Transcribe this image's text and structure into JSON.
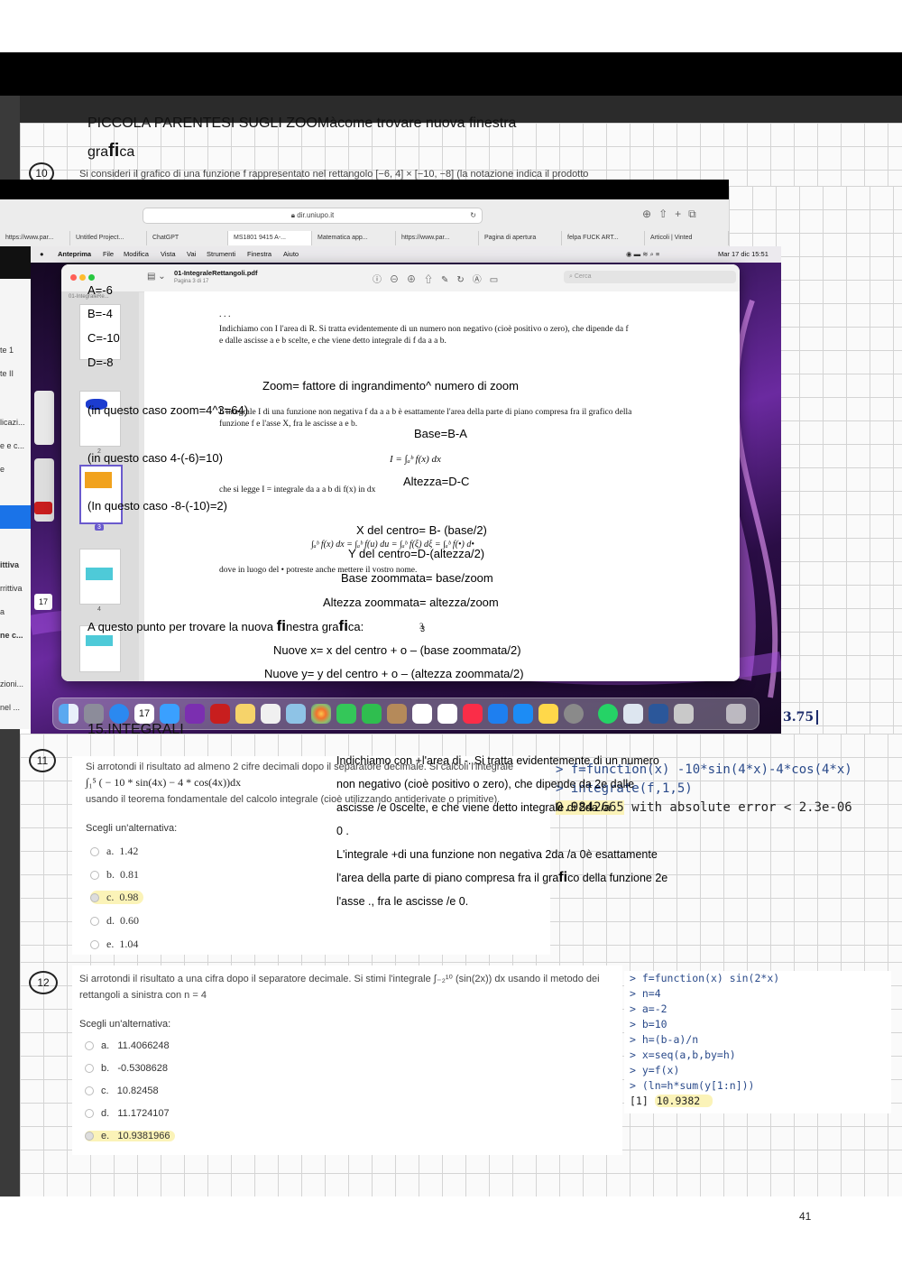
{
  "heading": {
    "line1": "PICCOLA PARENTESI SUGLI ZOOMàcome trovare nuova fi",
    "line1b": "nestra",
    "line2a": "gra",
    "line2b": "fi",
    "line2c": "ca"
  },
  "q10": {
    "number": "10",
    "text": "Si consideri il grafico di una funzione f rappresentato nel rettangolo [−6, 4] × [−10, −8] (la notazione indica il prodotto"
  },
  "browser": {
    "url": "dir.uniupo.it",
    "tabs": [
      "https://www.par...",
      "Untitled Project...",
      "ChatGPT",
      "MS1801 9415 A-...",
      "Matematica app...",
      "https://www.par...",
      "Pagina di apertura",
      "felpa FUCK ART...",
      "Articoli | Vinted"
    ]
  },
  "menubar": {
    "items": [
      "Anteprima",
      "File",
      "Modifica",
      "Vista",
      "Vai",
      "Strumenti",
      "Finestra",
      "Aiuto"
    ],
    "clock": "Mar 17 dic  15:51"
  },
  "preview": {
    "filename": "01-IntegraleRettangoli.pdf",
    "page": "Pagina 3 di 17",
    "search_placeholder": "Cerca",
    "sidebar_label": "01-IntegraleRe...",
    "thumb_numbers": [
      "2",
      "3",
      "4"
    ]
  },
  "left_sidebar": [
    "te 1",
    "te II",
    "licazi...",
    "e e c...",
    "e",
    "ittiva",
    "rrittiva",
    "a",
    "ne c...",
    "zioni...",
    "nel ..."
  ],
  "pdf_text": {
    "dots": ". . .",
    "p1": "Indichiamo con I l'area di R. Si tratta evidentemente di un numero non negativo (cioè positivo o zero), che dipende da f e dalle ascisse a e b scelte, e che viene detto integrale di f da a a b.",
    "p2": "L'integrale I di una funzione non negativa f da a a b è esattamente l'area della parte di piano compresa fra il grafico della funzione f e l'asse X, fra le ascisse a e b.",
    "formula": "I = ∫ₐᵇ f(x) dx",
    "p3": "che si legge  I = integrale da a a b di f(x) in dx",
    "formula2": "∫ₐᵇ f(x) dx = ∫ₐᵇ f(u) du = ∫ₐᵇ f(ξ) dξ = ∫ₐᵇ f(•) d•",
    "p4": "dove in luogo del • potreste anche mettere il vostro nome.",
    "page_num": "3"
  },
  "overlay": {
    "A": "A=-6",
    "B": "B=-4",
    "C": "C=-10",
    "D": "D=-8",
    "zoom": "Zoom= fattore di ingrandimento^ numero di zoom",
    "case1": "(in questo caso zoom=4^3=64)",
    "base": "Base=B-A",
    "case2": "(in questo caso 4-(-6)=10)",
    "altezza": "Altezza=D-C",
    "case3": "(In questo caso -8-(-10)=2)",
    "xc": "X del centro= B- (base/2)",
    "yc": "Y del centro=D-(altezza/2)",
    "bz": "Base zoommata= base/zoom",
    "az": "Altezza zoommata= altezza/zoom",
    "nf1": "A questo punto per trovare la nuova ",
    "nf2": "fi",
    "nf3": "nestra gra",
    "nf4": "fi",
    "nf5": "ca:",
    "page3": "3",
    "nx": "Nuove x= x del centro + o – (base zoommata/2)",
    "ny": "Nuove y= y del centro + o – (altezza zoommata/2)",
    "section": "15.INTEGRALI",
    "p1": "Indichiamo con +l'area di -. Si tratta evidentemente di un numero",
    "p2": "non negativo (cioè positivo o zero), che dipende da 2e dalle",
    "p3": "ascisse /e 0scelte, e che viene detto integrale di 2da /a",
    "p4": "0 .",
    "p5": "L'integrale +di una funzione non negativa 2da /a 0è esattamente",
    "p6a": "l'area della parte di piano compresa fra il gra",
    "p6b": "fi",
    "p6c": "co della funzione 2e",
    "p7": "l'asse ., fra le ascisse /e 0."
  },
  "handwriting": {
    "score": "3.75"
  },
  "q11": {
    "number": "11",
    "text1": "Si arrotondi il risultato ad almeno 2 cifre decimali dopo il separatore decimale. Si calcoli l'integrale",
    "integral": "∫₁⁵ ( − 10 * sin(4x) − 4 * cos(4x))dx",
    "text2": "usando il teorema fondamentale del calcolo integrale (cioè utilizzando antiderivate o primitive).",
    "prompt": "Scegli un'alternativa:",
    "choices": [
      {
        "letter": "a.",
        "value": "1.42"
      },
      {
        "letter": "b.",
        "value": "0.81"
      },
      {
        "letter": "c.",
        "value": "0.98"
      },
      {
        "letter": "d.",
        "value": "0.60"
      },
      {
        "letter": "e.",
        "value": "1.04"
      }
    ],
    "selected": 2,
    "code1": "> f=function(x) -10*sin(4*x)-4*cos(4*x)",
    "code2": "> integrate(f,1,5)",
    "result_val": "0.9842665",
    "result_rest": " with absolute error < 2.3e-06"
  },
  "q12": {
    "number": "12",
    "text1": "Si arrotondi il risultato a una cifra dopo il separatore decimale. Si stimi l'integrale ∫₋₂¹⁰ (sin(2x)) dx usando il metodo dei",
    "text2": "rettangoli a sinistra con n = 4",
    "prompt": "Scegli un'alternativa:",
    "choices": [
      {
        "letter": "a.",
        "value": "11.4066248"
      },
      {
        "letter": "b.",
        "value": "-0.5308628"
      },
      {
        "letter": "c.",
        "value": "10.82458"
      },
      {
        "letter": "d.",
        "value": "11.1724107"
      },
      {
        "letter": "e.",
        "value": "10.9381966"
      }
    ],
    "selected": 4,
    "code": [
      "> f=function(x) sin(2*x)",
      "> n=4",
      "> a=-2",
      "> b=10",
      "> h=(b-a)/n",
      "> x=seq(a,b,by=h)",
      "> y=f(x)",
      "> (ln=h*sum(y[1:n]))"
    ],
    "result_prefix": "[1] ",
    "result_val": "10.9382"
  },
  "page_number": "41"
}
